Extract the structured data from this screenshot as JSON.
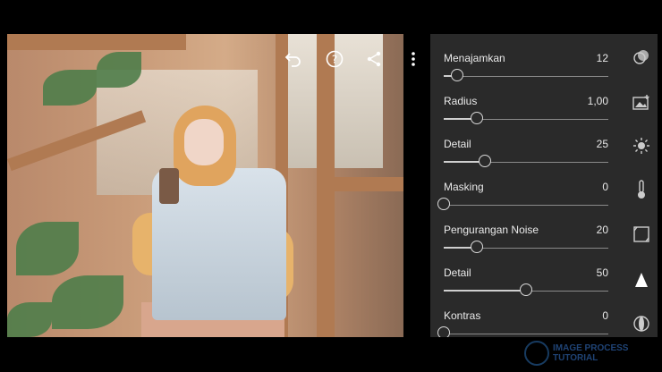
{
  "sliders": [
    {
      "label": "Menajamkan",
      "value": "12",
      "level": 0.08
    },
    {
      "label": "Radius",
      "value": "1,00",
      "level": 0.2
    },
    {
      "label": "Detail",
      "value": "25",
      "level": 0.25
    },
    {
      "label": "Masking",
      "value": "0",
      "level": 0.0
    },
    {
      "label": "Pengurangan Noise",
      "value": "20",
      "level": 0.2
    },
    {
      "label": "Detail",
      "value": "50",
      "level": 0.5
    },
    {
      "label": "Kontras",
      "value": "0",
      "level": 0.0
    }
  ],
  "top_tools": [
    "undo-icon",
    "help-icon",
    "share-icon",
    "more-icon"
  ],
  "side_tools": [
    "presets-icon",
    "image-edit-icon",
    "light-icon",
    "color-icon",
    "crop-icon",
    "detail-icon",
    "optics-icon"
  ],
  "watermark": {
    "line1": "IMAGE PROCESS",
    "line2": "TUTORIAL"
  },
  "colors": {
    "panel": "#2a2a2a",
    "background": "#000000",
    "accent": "#ffffff"
  }
}
